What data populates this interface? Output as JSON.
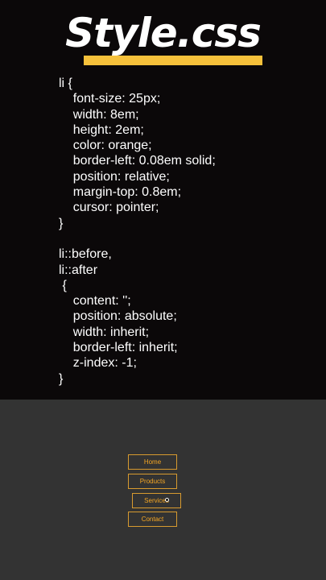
{
  "title": "Style.css",
  "code": [
    "li {",
    "    font-size: 25px;",
    "    width: 8em;",
    "    height: 2em;",
    "    color: orange;",
    "    border-left: 0.08em solid;",
    "    position: relative;",
    "    margin-top: 0.8em;",
    "    cursor: pointer;",
    "}",
    "",
    "li::before,",
    "li::after",
    " {",
    "    content: '';",
    "    position: absolute;",
    "    width: inherit;",
    "    border-left: inherit;",
    "    z-index: -1;",
    "}"
  ],
  "menu": [
    "Home",
    "Products",
    "Services",
    "Contact"
  ],
  "colors": {
    "code_background": "#0b0809",
    "demo_background": "#333333",
    "accent": "#f6c13b",
    "menu_text": "#f5a623"
  }
}
